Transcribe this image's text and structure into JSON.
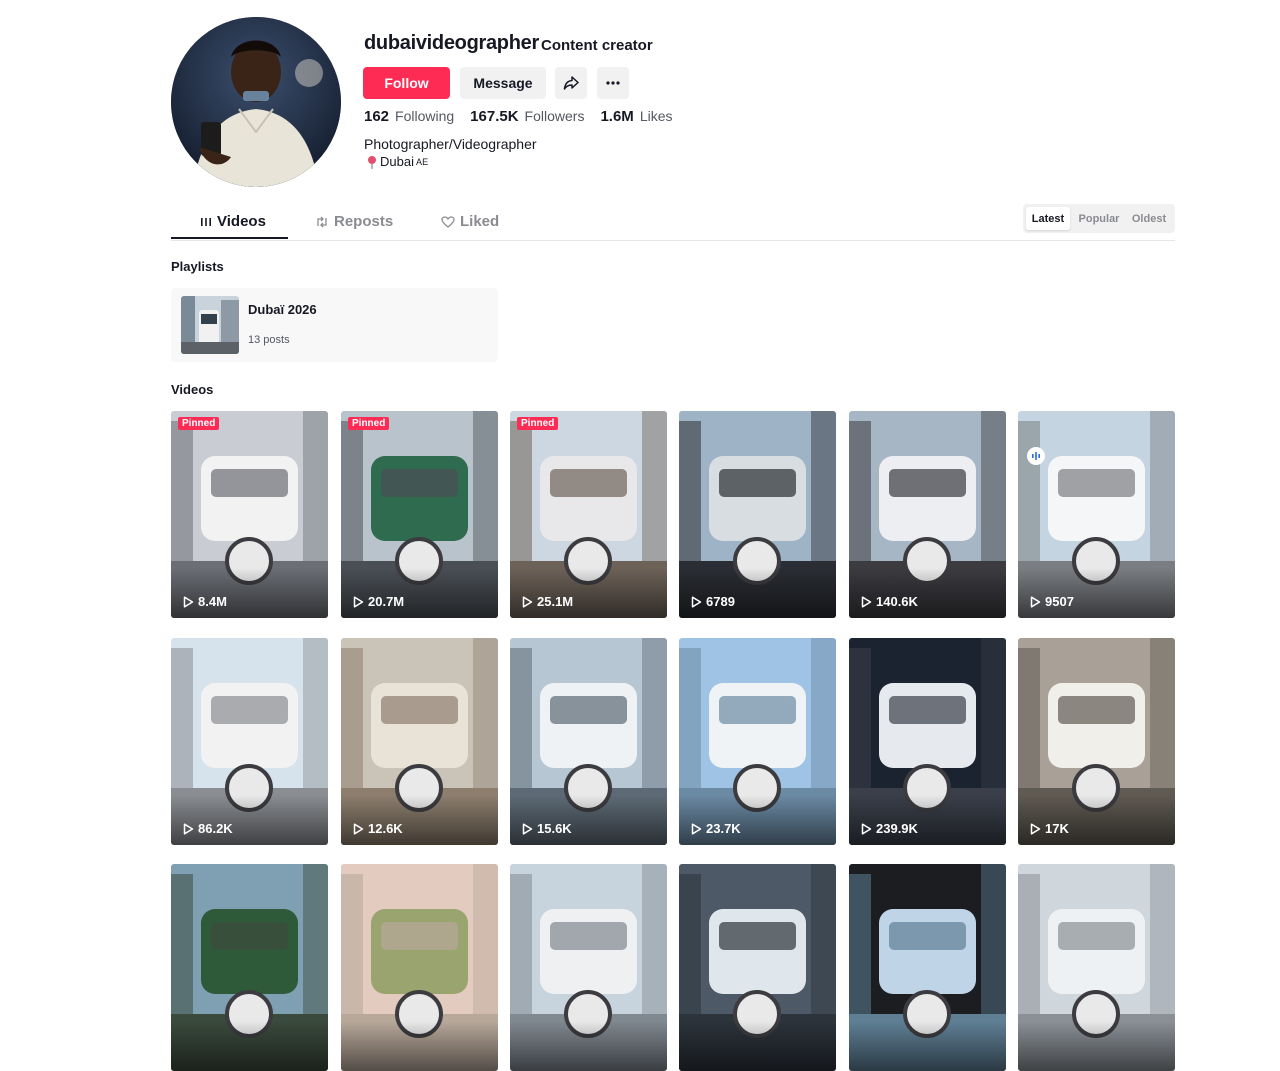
{
  "profile": {
    "username": "dubaivideographer",
    "nickname": "Content creator",
    "follow_label": "Follow",
    "message_label": "Message",
    "stats": [
      {
        "value": "162",
        "label": "Following"
      },
      {
        "value": "167.5K",
        "label": "Followers"
      },
      {
        "value": "1.6M",
        "label": "Likes"
      }
    ],
    "bio": "Photographer/Videographer",
    "location": "Dubai",
    "location_suffix": "AE"
  },
  "tabs": [
    {
      "label": "Videos",
      "icon": "grid-icon",
      "active": true
    },
    {
      "label": "Reposts",
      "icon": "repost-icon",
      "active": false
    },
    {
      "label": "Liked",
      "icon": "heart-icon",
      "active": false
    }
  ],
  "sort": [
    {
      "label": "Latest",
      "active": true
    },
    {
      "label": "Popular",
      "active": false
    },
    {
      "label": "Oldest",
      "active": false
    }
  ],
  "playlists_title": "Playlists",
  "playlist": {
    "title": "Dubaï 2026",
    "count": "13 posts"
  },
  "videos_title": "Videos",
  "pinned_label": "Pinned",
  "videos": [
    {
      "views": "8.4M",
      "pinned": true,
      "theme": [
        "#c9ccd3",
        "#f2f2f2",
        "#6b6e75"
      ]
    },
    {
      "views": "20.7M",
      "pinned": true,
      "theme": [
        "#b8c3cc",
        "#2f6b4e",
        "#4a4f55"
      ]
    },
    {
      "views": "25.1M",
      "pinned": true,
      "theme": [
        "#cdd7e2",
        "#e8e8ea",
        "#6d6258"
      ]
    },
    {
      "views": "6789",
      "pinned": false,
      "theme": [
        "#9fb3c6",
        "#d8dde2",
        "#2a2d33"
      ]
    },
    {
      "views": "140.6K",
      "pinned": false,
      "theme": [
        "#a7b6c4",
        "#eceef1",
        "#3b3b40"
      ]
    },
    {
      "views": "9507",
      "pinned": false,
      "audio": true,
      "theme": [
        "#c4d4e0",
        "#f4f6f8",
        "#7a7d82"
      ]
    },
    {
      "views": "86.2K",
      "pinned": false,
      "theme": [
        "#d7e3ec",
        "#f2f2f2",
        "#8a8d92"
      ]
    },
    {
      "views": "12.6K",
      "pinned": false,
      "theme": [
        "#c9c3b8",
        "#e9e2d6",
        "#8d7e6e"
      ]
    },
    {
      "views": "15.6K",
      "pinned": false,
      "theme": [
        "#b6c7d3",
        "#eff2f4",
        "#5d6a75"
      ]
    },
    {
      "views": "23.7K",
      "pinned": false,
      "theme": [
        "#9fc3e4",
        "#f0f3f6",
        "#6b8aa4"
      ]
    },
    {
      "views": "239.9K",
      "pinned": false,
      "theme": [
        "#1b2330",
        "#e6e9ee",
        "#3a3f4a"
      ]
    },
    {
      "views": "17K",
      "pinned": false,
      "theme": [
        "#a9a197",
        "#f1efe9",
        "#5f5a52"
      ]
    },
    {
      "views": "",
      "pinned": false,
      "theme": [
        "#7fa0b3",
        "#2f5a3a",
        "#3a4a3c"
      ]
    },
    {
      "views": "",
      "pinned": false,
      "theme": [
        "#e3cbbf",
        "#9aa46e",
        "#b7a89a"
      ]
    },
    {
      "views": "",
      "pinned": false,
      "theme": [
        "#c7d4dd",
        "#eef0f2",
        "#808890"
      ]
    },
    {
      "views": "",
      "pinned": false,
      "theme": [
        "#4d5966",
        "#dfe6ec",
        "#2c333b"
      ]
    },
    {
      "views": "",
      "pinned": false,
      "theme": [
        "#1b1d21",
        "#bfd4e6",
        "#5f7f95"
      ]
    },
    {
      "views": "",
      "pinned": false,
      "theme": [
        "#cfd6dc",
        "#eef1f3",
        "#8a9096"
      ]
    }
  ]
}
